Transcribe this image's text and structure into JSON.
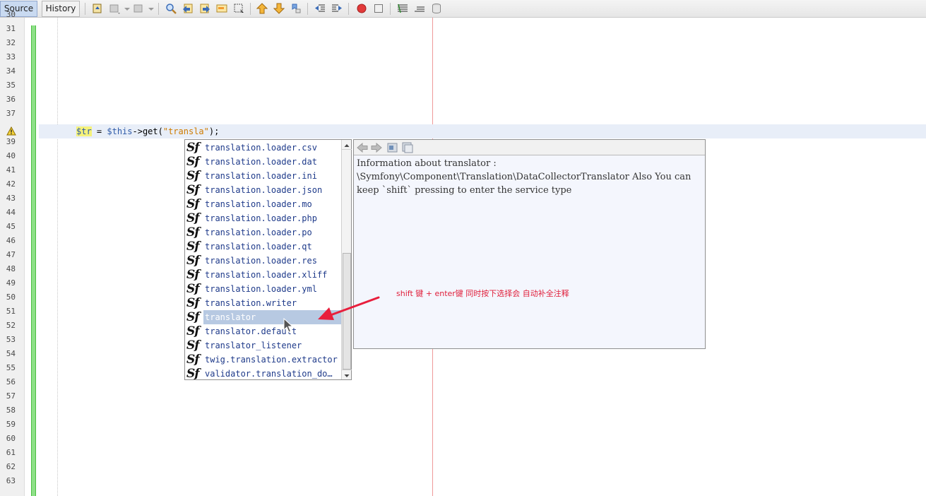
{
  "toolbar": {
    "tabs": [
      {
        "label": "Source",
        "active": true
      },
      {
        "label": "History",
        "active": false
      }
    ],
    "icons": [
      "last-edit-icon",
      "back-icon",
      "forward-icon",
      "find-selection-icon",
      "find-previous-icon",
      "find-next-icon",
      "toggle-highlight-icon",
      "toggle-rectangular-selection-icon",
      "previous-bookmark-icon",
      "next-bookmark-icon",
      "toggle-bookmark-icon",
      "shift-left-icon",
      "shift-right-icon",
      "start-macro-icon",
      "stop-macro-icon",
      "comment-icon",
      "uncomment-icon",
      "database-icon"
    ]
  },
  "editor": {
    "line_numbers": [
      "30",
      "31",
      "32",
      "33",
      "34",
      "35",
      "36",
      "37",
      "38",
      "39",
      "40",
      "41",
      "42",
      "43",
      "44",
      "45",
      "46",
      "47",
      "48",
      "49",
      "50",
      "51",
      "52",
      "53",
      "54",
      "55",
      "56",
      "57",
      "58",
      "59",
      "60",
      "61",
      "62",
      "63"
    ],
    "warning_line": "38",
    "code": {
      "var_name_hl": "$tr",
      "equals": " = ",
      "this_var": "$this",
      "call": "->get(",
      "string": "\"transla\"",
      "end": ");"
    }
  },
  "completion": {
    "items": [
      {
        "label": "translation.loader.csv",
        "selected": false
      },
      {
        "label": "translation.loader.dat",
        "selected": false
      },
      {
        "label": "translation.loader.ini",
        "selected": false
      },
      {
        "label": "translation.loader.json",
        "selected": false
      },
      {
        "label": "translation.loader.mo",
        "selected": false
      },
      {
        "label": "translation.loader.php",
        "selected": false
      },
      {
        "label": "translation.loader.po",
        "selected": false
      },
      {
        "label": "translation.loader.qt",
        "selected": false
      },
      {
        "label": "translation.loader.res",
        "selected": false
      },
      {
        "label": "translation.loader.xliff",
        "selected": false
      },
      {
        "label": "translation.loader.yml",
        "selected": false
      },
      {
        "label": "translation.writer",
        "selected": false
      },
      {
        "label": "translator",
        "selected": true
      },
      {
        "label": "translator.default",
        "selected": false
      },
      {
        "label": "translator_listener",
        "selected": false
      },
      {
        "label": "twig.translation.extractor",
        "selected": false
      },
      {
        "label": "validator.translation_do…",
        "selected": false
      }
    ],
    "item_icon_text": "Sf",
    "scroll_fraction": 0.55
  },
  "doc": {
    "text": "Information about translator : \\Symfony\\Component\\Translation\\DataCollectorTranslator Also You can keep `shift` pressing to enter the service type",
    "buttons": [
      "back-icon",
      "forward-icon",
      "goto-source-icon",
      "open-browser-icon"
    ]
  },
  "annotation": {
    "text": "shift 键 + enter键  同时按下选择会 自动补全注释",
    "color": "#e0203c"
  }
}
